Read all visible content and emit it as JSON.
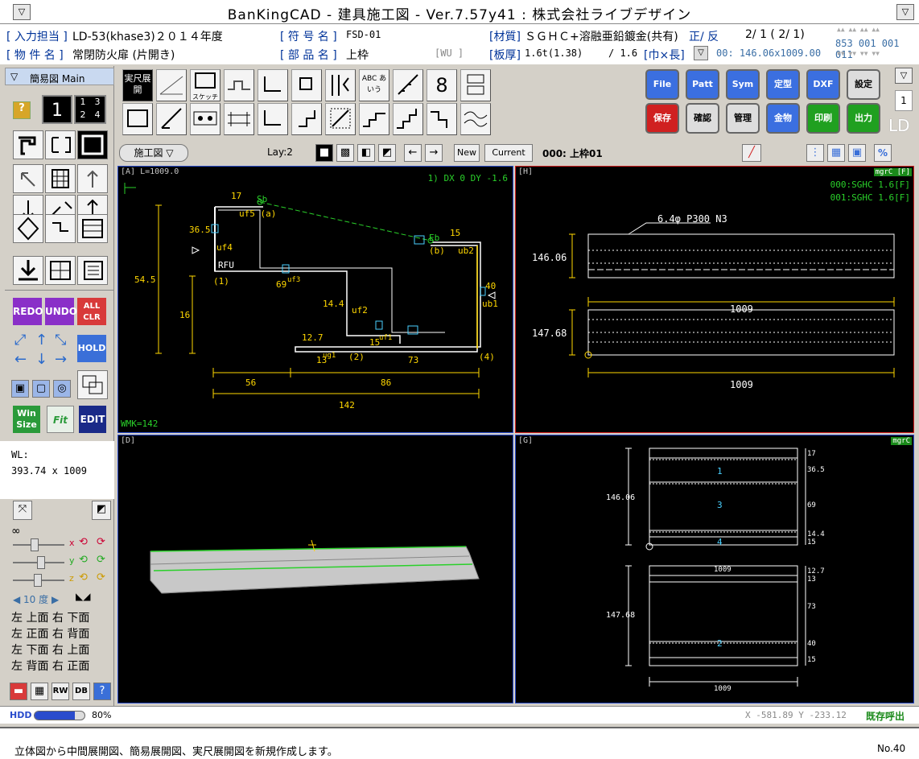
{
  "window": {
    "title": "BanKingCAD - 建具施工図 - Ver.7.57y41 : 株式会社ライブデザイン"
  },
  "info": {
    "input_label": "[ 入力担当 ]",
    "input_value": "LD-53(khase3)２０１４年度",
    "symbol_label": "[ 符 号 名 ]",
    "symbol_value": "FSD-01",
    "material_label": "[材質]",
    "material_value": "ＳＧＨＣ+溶融亜鉛鍍金(共有)",
    "orient": "正/ 反",
    "page": "2/ 1 ( 2/ 1)",
    "counters_top": "▲▲ ▲▲ ▲▲ ▲▲",
    "counters": "853 001 001 011",
    "counters_bottom": "▼▼ ▼▼ ▼▼ ▼▼",
    "project_label": "[ 物 件 名 ]",
    "project_value": "常閉防火扉 (片開き)",
    "part_label": "[ 部 品 名 ]",
    "part_value": "上枠",
    "wu": "[WU ]",
    "thickness_label": "[板厚]",
    "thickness_value": "1.6t(1.38)",
    "thickness_2": "/ 1.6",
    "size_label": "[巾×長]",
    "size_value": "00: 146.06x1009.00"
  },
  "sidebar": {
    "mode_label": "簡易図 Main",
    "num_one": "1",
    "num_grid": "1 3 2 4",
    "redo": "REDO",
    "undo": "UNDO",
    "all_clr": "ALL CLR",
    "hold": "HOLD",
    "win_size": "Win Size",
    "fit": "Fit",
    "edit": "EDIT",
    "wl_label": "WL:",
    "wl_value": "393.74 x 1009",
    "infinity": "∞",
    "axis_x": "x",
    "axis_y": "y",
    "axis_z": "z",
    "degree": "◀ 10 度 ▶",
    "views": [
      [
        "左",
        "上面",
        "右",
        "下面"
      ],
      [
        "左",
        "正面",
        "右",
        "背面"
      ],
      [
        "左",
        "下面",
        "右",
        "上面"
      ],
      [
        "左",
        "背面",
        "右",
        "正面"
      ]
    ],
    "rw": "RW",
    "db": "DB"
  },
  "toolbar": {
    "jitsu": "実尺展開",
    "sketch": "スケッチ",
    "abc": "ABC あいう",
    "right_buttons": [
      {
        "label": "File",
        "color": "#3b6fe0"
      },
      {
        "label": "Patt",
        "color": "#3b6fe0"
      },
      {
        "label": "Sym",
        "color": "#3b6fe0"
      },
      {
        "label": "定型",
        "color": "#3b6fe0"
      },
      {
        "label": "DXF",
        "color": "#3b6fe0"
      },
      {
        "label": "設定",
        "color": "#2b2b2b"
      },
      {
        "label": "保存",
        "color": "#d02020"
      },
      {
        "label": "確認",
        "color": "#2b2b2b"
      },
      {
        "label": "管理",
        "color": "#2b2b2b"
      },
      {
        "label": "金物",
        "color": "#3b6fe0"
      },
      {
        "label": "印刷",
        "color": "#20a020"
      },
      {
        "label": "出力",
        "color": "#20a020"
      }
    ],
    "ld": "LD",
    "page_num": "1"
  },
  "toolbar2": {
    "view_select": "施工図 ▽",
    "lay": "Lay:2",
    "new_btn": "New",
    "current_btn": "Current",
    "current_name": "000: 上枠01"
  },
  "paneA": {
    "title": "[A]  L=1009.0",
    "dxdy": "1) DX    0 DY -1.6",
    "wmk": "WMK=142",
    "labels": {
      "d17": "17",
      "sb": "Sb",
      "uf5": "uf5 (a)",
      "d365": "36.5",
      "uf4": "uf4",
      "rfu": "RFU",
      "p1": "(1)",
      "d69": "69",
      "uf3": "uf3",
      "d545": "54.5",
      "d16": "16",
      "d144": "14.4",
      "uf2": "uf2",
      "d127": "12.7",
      "d15a": "15",
      "uf1": "uf1",
      "d13": "13",
      "ug1": "ug1",
      "p2": "(2)",
      "d73": "73",
      "p4": "(4)",
      "eb": "Eb",
      "d15b": "15",
      "b": "(b)",
      "ub2": "ub2",
      "d40": "40",
      "ub1": "ub1",
      "d56": "56",
      "d86": "86",
      "d142": "142"
    }
  },
  "paneH": {
    "title": "[H]",
    "tag": "mgrC [F]",
    "line1": "000:SGHC 1.6[F]",
    "line2": "001:SGHC 1.6[F]",
    "hole": "6.4φ P300 N3",
    "d14606": "146.06",
    "d1009a": "1009",
    "d14768": "147.68",
    "d1009b": "1009"
  },
  "paneD": {
    "title": "[D]"
  },
  "paneG": {
    "title": "[G]",
    "tag": "mgrC",
    "d14606": "146.06",
    "d14768": "147.68",
    "n1": "1",
    "n3": "3",
    "n4": "4",
    "n2": "2",
    "r17": "17",
    "r365": "36.5",
    "r69": "69",
    "r144": "14.4",
    "r15a": "15",
    "r127": "12.7",
    "r13": "13",
    "r73": "73",
    "r40": "40",
    "r15b": "15",
    "top1009": "1009",
    "bot1009": "1009"
  },
  "status": {
    "hdd": "HDD",
    "pct": "80%",
    "hdd_fill": 0.8,
    "coords": "X -581.89 Y -233.12",
    "existing": "既存呼出"
  },
  "message": {
    "text": "立体図から中間展開図、簡易展開図、実尺展開図を新規作成します。",
    "no": "No.40"
  }
}
